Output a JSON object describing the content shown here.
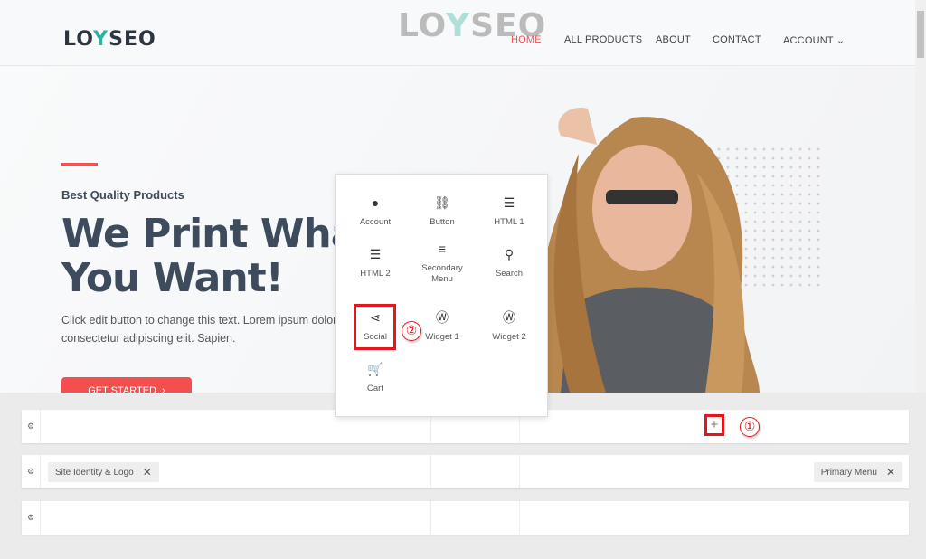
{
  "header": {
    "logo": {
      "l": "LO",
      "y": "Y",
      "r": "SEO"
    },
    "watermark": {
      "l": "LO",
      "y": "Y",
      "r": "SEO"
    },
    "nav": [
      {
        "label": "HOME",
        "active": true
      },
      {
        "label": "ALL PRODUCTS"
      },
      {
        "label": "ABOUT"
      },
      {
        "label": "CONTACT"
      },
      {
        "label": "ACCOUNT",
        "chevron": "⌄"
      }
    ]
  },
  "hero": {
    "subtitle": "Best Quality Products",
    "title_line1": "We Print What",
    "title_line2": "You Want!",
    "description": "Click edit button to change this text. Lorem ipsum dolor consectetur adipiscing elit. Sapien.",
    "cta": "GET STARTED",
    "cta_icon": "›"
  },
  "popup": {
    "items": [
      {
        "label": "Account",
        "icon": "person-icon",
        "glyph": "👤"
      },
      {
        "label": "Button",
        "icon": "link-icon",
        "glyph": "🔗"
      },
      {
        "label": "HTML 1",
        "icon": "html-icon",
        "glyph": "☰"
      },
      {
        "label": "HTML 2",
        "icon": "html-icon",
        "glyph": "☰"
      },
      {
        "label": "Secondary Menu",
        "icon": "menu-icon",
        "glyph": "≡"
      },
      {
        "label": "Search",
        "icon": "search-icon",
        "glyph": "🔍"
      },
      {
        "label": "Social",
        "icon": "share-icon",
        "glyph": "<"
      },
      {
        "label": "Widget 1",
        "icon": "wordpress-icon",
        "glyph": "W"
      },
      {
        "label": "Widget 2",
        "icon": "wordpress-icon",
        "glyph": "W"
      },
      {
        "label": "Cart",
        "icon": "cart-icon",
        "glyph": "🛒"
      }
    ]
  },
  "builder": {
    "gear": "⚙",
    "add": "+",
    "annotation1": "①",
    "annotation2": "②",
    "chips": [
      {
        "label": "Site Identity & Logo",
        "close": "✕"
      },
      {
        "label": "Primary Menu",
        "close": "✕"
      }
    ]
  },
  "colors": {
    "accent": "#f44f4f",
    "annotation": "#e8141c",
    "text": "#3d4b5c"
  }
}
